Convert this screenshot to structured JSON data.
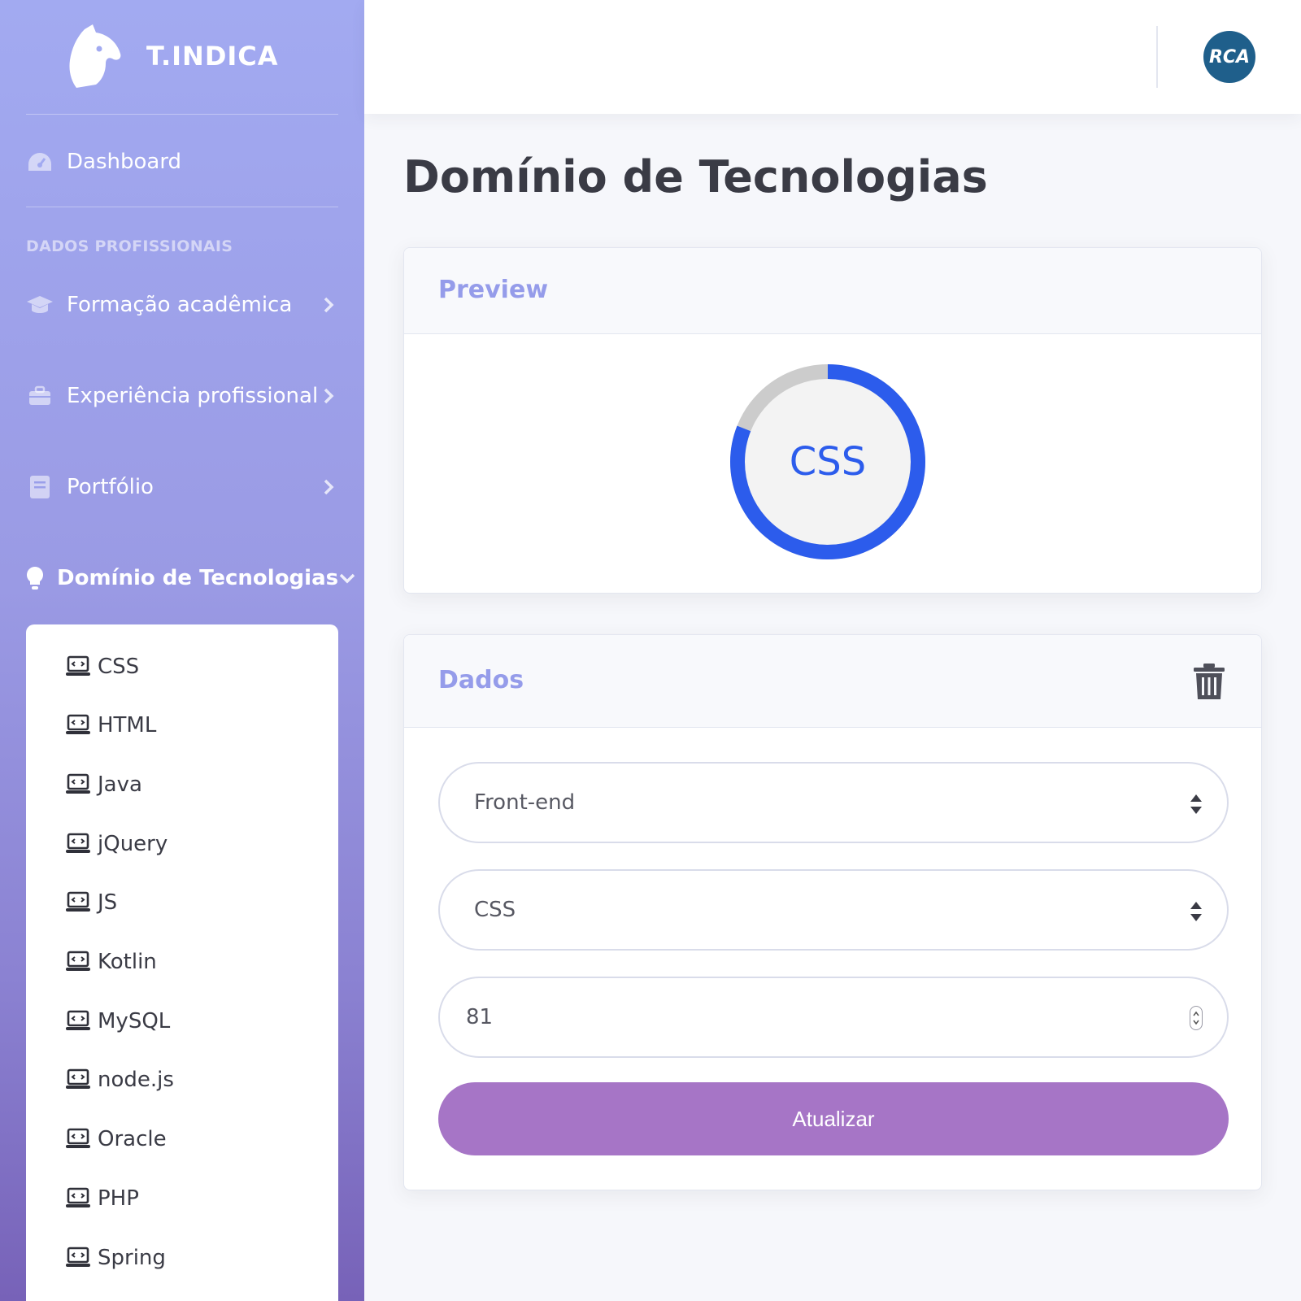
{
  "brand": {
    "name": "T.INDICA"
  },
  "sidebar": {
    "dashboard_label": "Dashboard",
    "section_title": "DADOS PROFISSIONAIS",
    "items": [
      {
        "label": "Formação acadêmica",
        "icon": "graduation-cap-icon"
      },
      {
        "label": "Experiência profissional",
        "icon": "briefcase-icon"
      },
      {
        "label": "Portfólio",
        "icon": "book-icon"
      },
      {
        "label": "Domínio de Tecnologias",
        "icon": "lightbulb-icon",
        "active": true
      }
    ],
    "submenu": [
      "CSS",
      "HTML",
      "Java",
      "jQuery",
      "JS",
      "Kotlin",
      "MySQL",
      "node.js",
      "Oracle",
      "PHP",
      "Spring"
    ]
  },
  "topbar": {
    "avatar_text": "RCA"
  },
  "page": {
    "title": "Domínio de Tecnologias"
  },
  "preview": {
    "title": "Preview",
    "label": "CSS",
    "progress_percent": 81,
    "ring_color": "#2c5cec",
    "track_color": "#cccccc"
  },
  "form": {
    "title": "Dados",
    "category_value": "Front-end",
    "technology_value": "CSS",
    "level_value": "81",
    "submit_label": "Atualizar"
  },
  "colors": {
    "accent": "#959cea",
    "button": "#a675c6",
    "ring": "#2c5cec"
  }
}
